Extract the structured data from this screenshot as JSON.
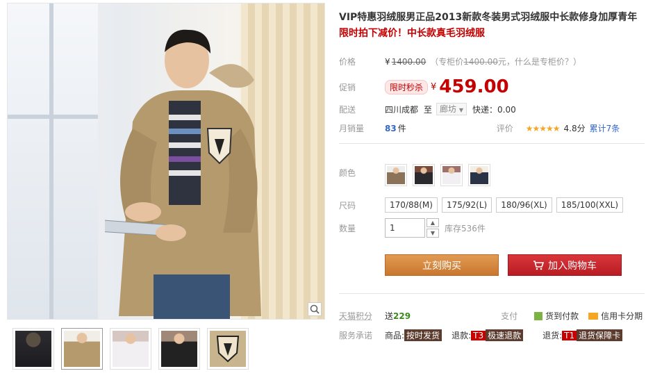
{
  "product": {
    "title": "VIP特惠羽绒服男正品2013新款冬装男式羽绒服中长款修身加厚青年",
    "subtitle": "限时拍下减价！中长款真毛羽绒服"
  },
  "price": {
    "label": "价格",
    "currency": "¥",
    "original": "1400.00",
    "counter_note_prefix": "（专柜价",
    "counter_price": "1400.00",
    "counter_note_suffix": "元，",
    "counter_link": "什么是专柜价？",
    "counter_close": "）"
  },
  "promo": {
    "label": "促销",
    "tag": "限时秒杀",
    "currency": "¥",
    "price": "459.00"
  },
  "delivery": {
    "label": "配送",
    "from": "四川成都",
    "to_word": "至",
    "to_city": "廊坊",
    "shipping": "快递：0.00"
  },
  "sales": {
    "label": "月销量",
    "count": "83",
    "unit": "件",
    "rating_label": "评价",
    "stars": "★★★★★",
    "score": "4.8分",
    "reviews": "累计7条"
  },
  "color": {
    "label": "颜色",
    "swatches": [
      "swatch-1",
      "swatch-2",
      "swatch-3",
      "swatch-4"
    ]
  },
  "size": {
    "label": "尺码",
    "options": [
      "170/88(M)",
      "175/92(L)",
      "180/96(XL)",
      "185/100(XXL)"
    ]
  },
  "quantity": {
    "label": "数量",
    "value": "1",
    "stock": "库存536件"
  },
  "buttons": {
    "buy": "立刻购买",
    "cart": "加入购物车"
  },
  "points": {
    "label": "天猫积分",
    "prefix": "送",
    "value": "229"
  },
  "payment": {
    "label": "支付",
    "cod": "货到付款",
    "credit": "信用卡分期"
  },
  "service": {
    "label": "服务承诺",
    "goods_prefix": "商品:",
    "goods_badge": "按时发货",
    "refund_prefix": "退款:",
    "refund_code": "T3",
    "refund_badge": "极速退款",
    "return_prefix": "退货:",
    "return_code": "T1",
    "return_badge": "退货保障卡"
  },
  "colors": {
    "accent_red": "#c40000",
    "buy_orange": "#c9772f",
    "cart_red": "#b81c22",
    "jacket_khaki": "#b59a6e"
  }
}
